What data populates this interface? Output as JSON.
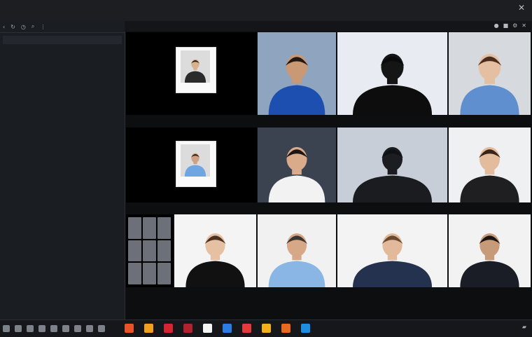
{
  "window": {
    "title": "",
    "menu": []
  },
  "sidebar": {
    "header": "",
    "search_placeholder": "",
    "toolbar_icons": [
      "back-icon",
      "refresh-icon",
      "clock-icon",
      "search-icon",
      "more-icon"
    ],
    "rows": []
  },
  "meeting": {
    "label": "",
    "top_icons": [
      "mic-icon",
      "camera-icon",
      "settings-icon",
      "close-icon"
    ],
    "tiles": [
      {
        "id": "tile-1",
        "type": "card",
        "bg": "#000000",
        "shirt": "#2b2b2b",
        "skin": "#d8b08e",
        "hair": "#2a1f18",
        "label": ""
      },
      {
        "id": "tile-2",
        "type": "person",
        "bg": "#8fa4bf",
        "shirt": "#1d4fb0",
        "skin": "#c99976",
        "hair": "#231914",
        "label": ""
      },
      {
        "id": "tile-3",
        "type": "silhouette",
        "bg": "#e8ecf2",
        "shirt": "#0d0d0d",
        "skin": "#151515",
        "hair": "#0a0a0a",
        "label": ""
      },
      {
        "id": "tile-4",
        "type": "person",
        "bg": "#d6d9de",
        "shirt": "#5f8fcf",
        "skin": "#e4bfa2",
        "hair": "#4b2d1e",
        "label": ""
      },
      {
        "id": "tile-5",
        "type": "card",
        "bg": "#000000",
        "shirt": "#6fa5e0",
        "skin": "#cfa184",
        "hair": "#2d1f17",
        "label": ""
      },
      {
        "id": "tile-6",
        "type": "person",
        "bg": "#3b4250",
        "shirt": "#f2f2f2",
        "skin": "#d9ab8a",
        "hair": "#1e1612",
        "label": ""
      },
      {
        "id": "tile-7",
        "type": "silhouette",
        "bg": "#c7ced8",
        "shirt": "#1a1c20",
        "skin": "#1c1d21",
        "hair": "#101114",
        "label": ""
      },
      {
        "id": "tile-8",
        "type": "person",
        "bg": "#eef0f2",
        "shirt": "#1f1f22",
        "skin": "#e3bb9d",
        "hair": "#3a2418",
        "label": ""
      },
      {
        "id": "tile-9",
        "type": "grid",
        "bg": "#000000",
        "label": ""
      },
      {
        "id": "tile-10",
        "type": "person",
        "bg": "#f4f4f4",
        "shirt": "#111111",
        "skin": "#e6c0a2",
        "hair": "#4a3122",
        "label": ""
      },
      {
        "id": "tile-11",
        "type": "person",
        "bg": "#f1f1f1",
        "shirt": "#8ab6e6",
        "skin": "#d6a888",
        "hair": "#3b342f",
        "label": ""
      },
      {
        "id": "tile-12",
        "type": "person",
        "bg": "#f3f3f3",
        "shirt": "#24324f",
        "skin": "#e2b99a",
        "hair": "#6a4a2f",
        "label": ""
      },
      {
        "id": "tile-13",
        "type": "person",
        "bg": "#f2f2f2",
        "shirt": "#1b1d26",
        "skin": "#c79a7a",
        "hair": "#1c1410",
        "label": ""
      }
    ]
  },
  "taskbar": {
    "small_icons": 9,
    "app_icons": [
      {
        "name": "media-app-icon",
        "color": "#e8532a"
      },
      {
        "name": "office-app-icon",
        "color": "#f0a020"
      },
      {
        "name": "pdf-app-icon",
        "color": "#d22630"
      },
      {
        "name": "video-app-icon",
        "color": "#b0222e"
      },
      {
        "name": "notes-app-icon",
        "color": "#f5f5f5"
      },
      {
        "name": "mail-app-icon",
        "color": "#2a7de1"
      },
      {
        "name": "calendar-app-icon",
        "color": "#e23b3b"
      },
      {
        "name": "folder-app-icon",
        "color": "#f2b01e"
      },
      {
        "name": "slides-app-icon",
        "color": "#e8691f"
      },
      {
        "name": "browser-app-icon",
        "color": "#1e8ee0"
      }
    ],
    "tray_icons": [
      "network-icon"
    ]
  }
}
